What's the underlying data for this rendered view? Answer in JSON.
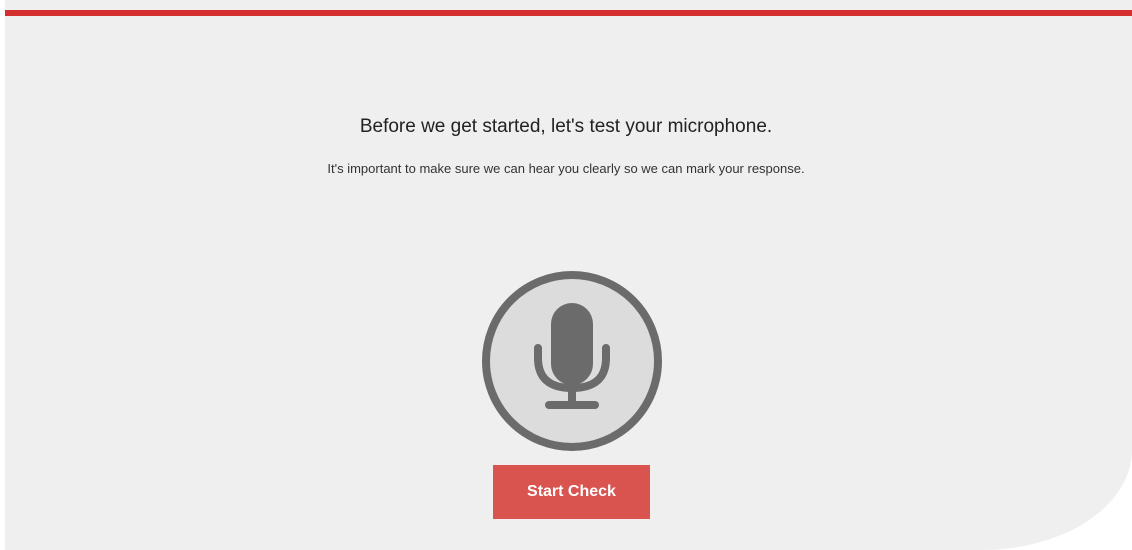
{
  "page": {
    "heading": "Before we get started, let's test your microphone.",
    "subheading": "It's important to make sure we can hear you clearly so we can mark your response."
  },
  "mic": {
    "icon": "microphone-icon"
  },
  "actions": {
    "start_label": "Start Check"
  },
  "colors": {
    "accent": "#d32f2f",
    "button": "#d9534f",
    "background": "#efefef",
    "icon": "#6b6b6b",
    "icon_fill": "#dcdcdc"
  }
}
